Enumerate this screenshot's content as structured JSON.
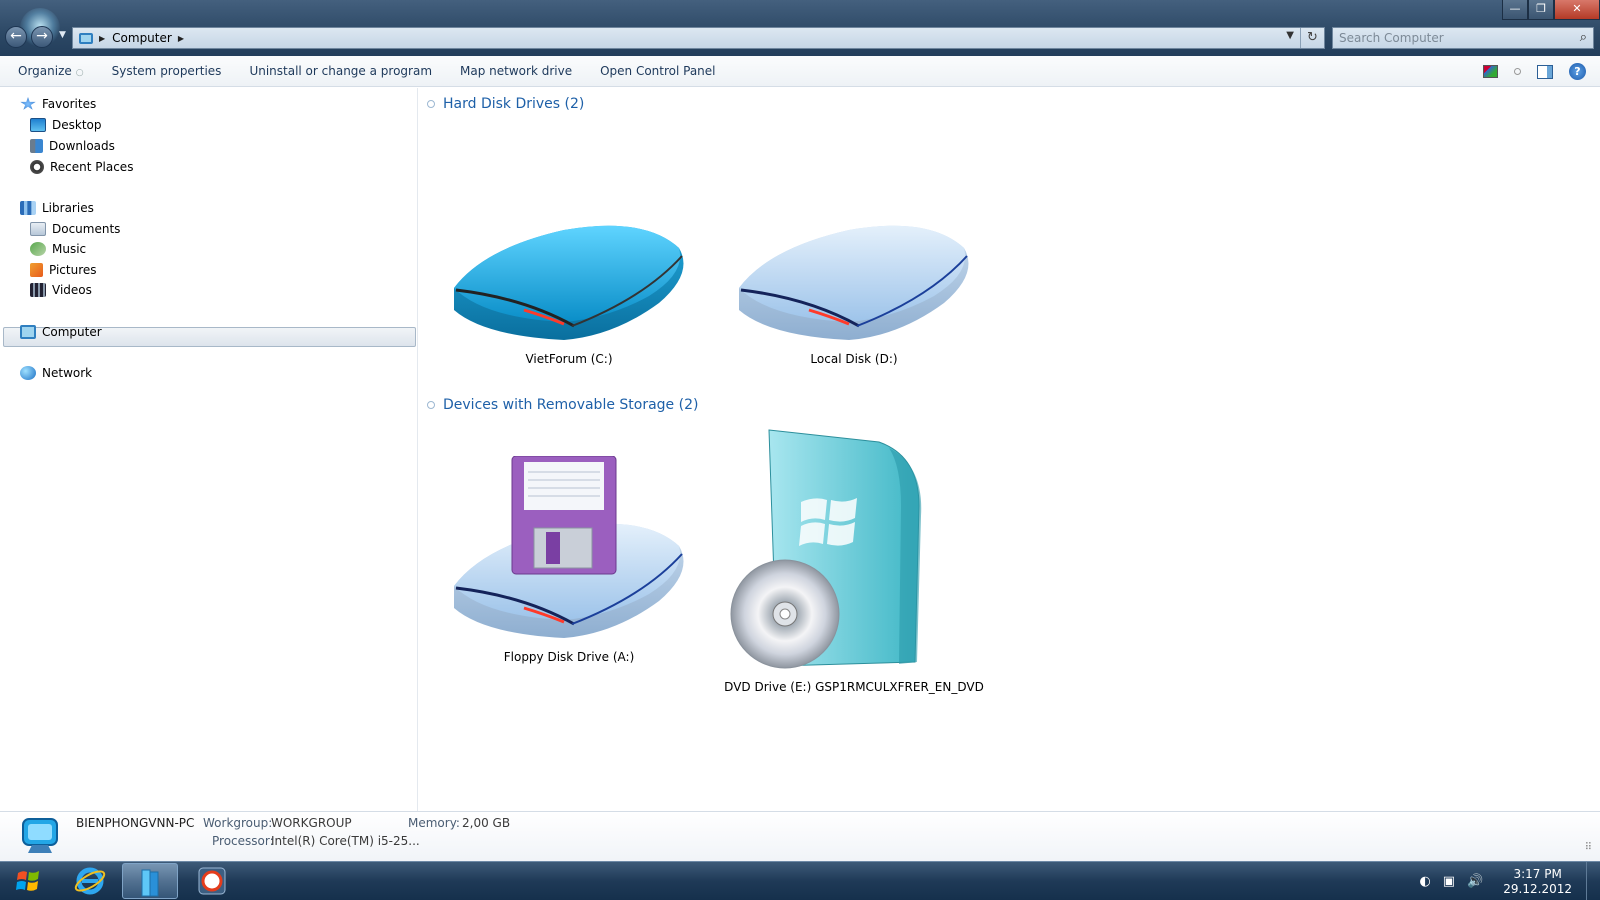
{
  "window": {
    "address_segments": [
      "Computer"
    ],
    "search_placeholder": "Search Computer",
    "controls": {
      "minimize": "—",
      "restore": "❐",
      "close": "✕"
    }
  },
  "toolbar": {
    "organize": "Organize",
    "system_properties": "System properties",
    "uninstall": "Uninstall or change a program",
    "map_drive": "Map network drive",
    "control_panel": "Open Control Panel"
  },
  "sidebar": {
    "favorites": {
      "label": "Favorites",
      "items": [
        "Desktop",
        "Downloads",
        "Recent Places"
      ]
    },
    "libraries": {
      "label": "Libraries",
      "items": [
        "Documents",
        "Music",
        "Pictures",
        "Videos"
      ]
    },
    "computer": "Computer",
    "network": "Network"
  },
  "groups": {
    "hdd": {
      "title": "Hard Disk Drives (2)",
      "drives": [
        {
          "label": "VietForum (C:)",
          "icon": "hard-drive-icon",
          "color": "#1fb4e8"
        },
        {
          "label": "Local Disk (D:)",
          "icon": "hard-drive-icon",
          "color": "#b6d3f0"
        }
      ]
    },
    "removable": {
      "title": "Devices with Removable Storage (2)",
      "drives": [
        {
          "label": "Floppy Disk Drive (A:)",
          "icon": "floppy-drive-icon",
          "color": "#9b5fbf"
        },
        {
          "label": "DVD Drive (E:) GSP1RMCULXFRER_EN_DVD",
          "icon": "dvd-drive-icon",
          "color": "#3fb7c6"
        }
      ]
    }
  },
  "details": {
    "pc_name": "BIENPHONGVNN-PC",
    "workgroup_label": "Workgroup:",
    "workgroup": "WORKGROUP",
    "memory_label": "Memory:",
    "memory": "2,00 GB",
    "processor_label": "Processor:",
    "processor": "Intel(R) Core(TM) i5-25..."
  },
  "taskbar": {
    "time": "3:17 PM",
    "date": "29.12.2012"
  }
}
